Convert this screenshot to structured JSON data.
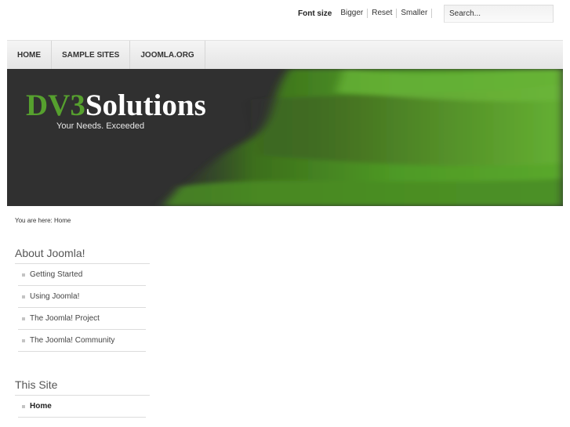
{
  "fontsize": {
    "label": "Font size",
    "bigger": "Bigger",
    "reset": "Reset",
    "smaller": "Smaller"
  },
  "search": {
    "value": "Search..."
  },
  "nav": {
    "items": [
      "HOME",
      "SAMPLE SITES",
      "JOOMLA.ORG"
    ]
  },
  "banner": {
    "logo_part1": "DV3",
    "logo_part2": "Solutions",
    "tagline": "Your Needs. Exceeded"
  },
  "breadcrumb": {
    "text": "You are here: Home"
  },
  "about": {
    "title": "About Joomla!",
    "items": [
      "Getting Started",
      "Using Joomla!",
      "The Joomla! Project",
      "The Joomla! Community"
    ]
  },
  "site": {
    "title": "This Site",
    "items": [
      "Home"
    ]
  },
  "colors": {
    "accent_green": "#56a02e",
    "banner_dark": "#303030"
  }
}
